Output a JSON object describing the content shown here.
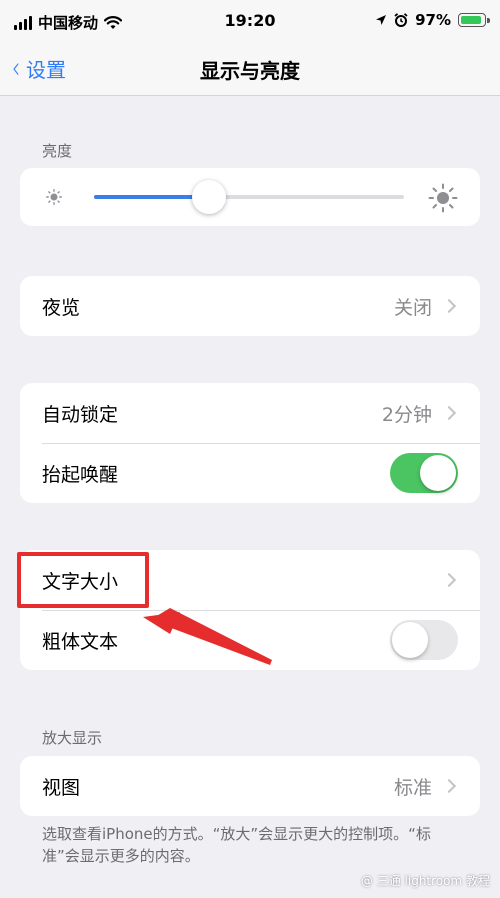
{
  "status_bar": {
    "carrier": "中国移动",
    "time": "19:20",
    "battery_percent": "97%",
    "battery_level": 0.97,
    "icons": [
      "signal-icon",
      "wifi-icon",
      "location-icon",
      "alarm-icon",
      "battery-icon"
    ]
  },
  "nav": {
    "back_label": "设置",
    "title": "显示与亮度"
  },
  "brightness": {
    "header": "亮度",
    "level": 0.37
  },
  "night_shift": {
    "label": "夜览",
    "value": "关闭"
  },
  "auto_lock": {
    "label": "自动锁定",
    "value": "2分钟"
  },
  "raise_to_wake": {
    "label": "抬起唤醒",
    "state": "on"
  },
  "text_size": {
    "label": "文字大小"
  },
  "bold_text": {
    "label": "粗体文本",
    "state": "off"
  },
  "zoom": {
    "header": "放大显示",
    "view_label": "视图",
    "view_value": "标准",
    "footer": "选取查看iPhone的方式。“放大”会显示更大的控制项。“标准”会显示更多的内容。"
  },
  "colors": {
    "accent": "#2f7cf6",
    "toggle_on": "#4bc462",
    "annotation": "#e52d2d",
    "background": "#efeff4"
  },
  "watermark": "@ 三通 lightroom 教程"
}
